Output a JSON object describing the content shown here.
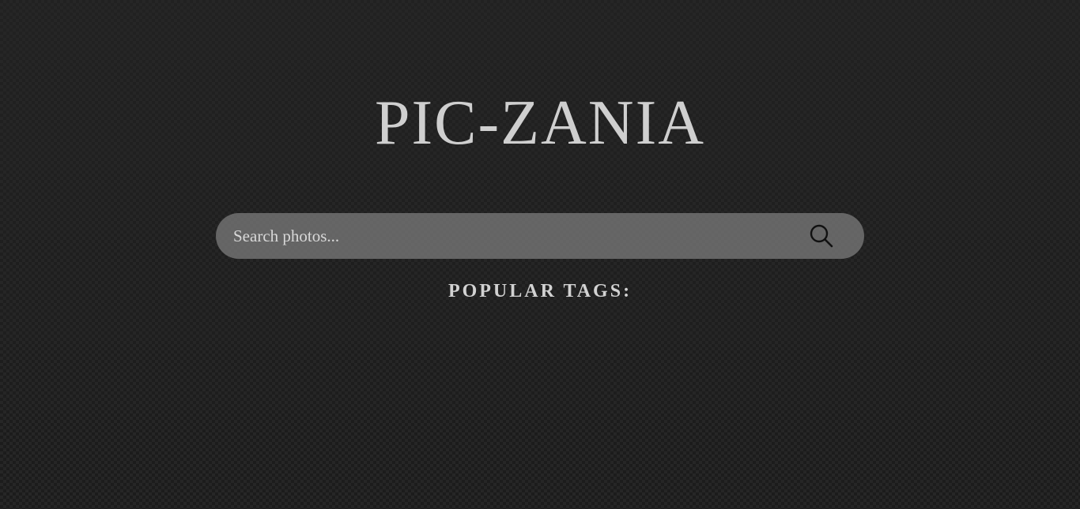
{
  "header": {
    "title": "PIC-ZANIA"
  },
  "search": {
    "placeholder": "Search photos...",
    "value": "",
    "icon": "search-icon"
  },
  "tags": {
    "heading": "POPULAR TAGS:",
    "items": []
  },
  "colors": {
    "background": "#1d1d1d",
    "title": "#cfcfcf",
    "search_bar": "#787878",
    "text": "#d2d2d2"
  }
}
